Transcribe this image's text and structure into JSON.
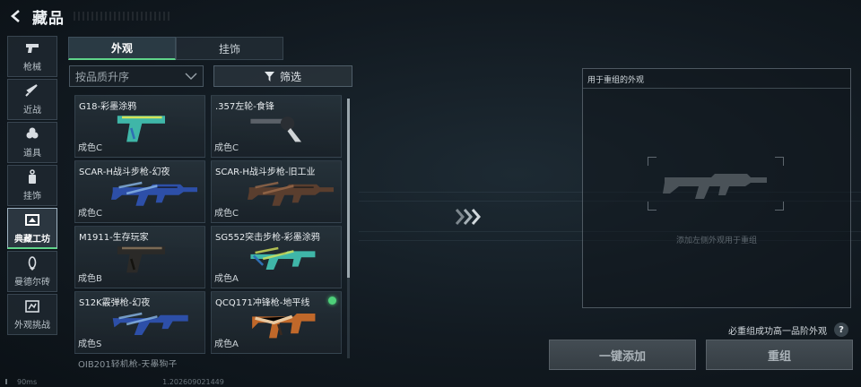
{
  "header": {
    "title": "藏品"
  },
  "sidebar": {
    "items": [
      {
        "label": "枪械",
        "icon": "pistol-icon",
        "active": false
      },
      {
        "label": "近战",
        "icon": "knife-icon",
        "active": false
      },
      {
        "label": "道具",
        "icon": "grenade-icon",
        "active": false
      },
      {
        "label": "挂饰",
        "icon": "charm-icon",
        "active": false
      },
      {
        "label": "典藏工坊",
        "icon": "workshop-icon",
        "active": true
      },
      {
        "label": "曼德尔砖",
        "icon": "brick-icon",
        "active": false
      },
      {
        "label": "外观挑战",
        "icon": "challenge-icon",
        "active": false
      }
    ]
  },
  "tabs": [
    {
      "label": "外观",
      "active": true
    },
    {
      "label": "挂饰",
      "active": false
    }
  ],
  "sort": {
    "value": "按品质升序"
  },
  "filter": {
    "label": "筛选"
  },
  "items": [
    {
      "name": "G18-彩墨涂鸦",
      "grade": "成色C",
      "gun": "pistol",
      "colors": [
        "#3fb6a8",
        "#d4e35a",
        "#2f6fb4"
      ]
    },
    {
      "name": ".357左轮-食锋",
      "grade": "成色C",
      "gun": "revolver",
      "colors": [
        "#2a2e33",
        "#5b6168",
        "#cfd3d6"
      ]
    },
    {
      "name": "SCAR-H战斗步枪-幻夜",
      "grade": "成色C",
      "gun": "rifle",
      "colors": [
        "#2d4fa8",
        "#8ab8e8",
        "#1a2340"
      ]
    },
    {
      "name": "SCAR-H战斗步枪-旧工业",
      "grade": "成色C",
      "gun": "rifle",
      "colors": [
        "#5a3e2e",
        "#9a6a4a",
        "#2a2420"
      ]
    },
    {
      "name": "M1911-生存玩家",
      "grade": "成色B",
      "gun": "pistol",
      "colors": [
        "#2b2a28",
        "#7a6a55",
        "#14130f"
      ]
    },
    {
      "name": "SG552突击步枪-彩墨涂鸦",
      "grade": "成色A",
      "gun": "carbine",
      "colors": [
        "#3fb6a8",
        "#d4e35a",
        "#2f6fb4"
      ]
    },
    {
      "name": "S12K霰弹枪-幻夜",
      "grade": "成色S",
      "gun": "shotgun",
      "colors": [
        "#2d4fa8",
        "#8ab8e8",
        "#1a2340"
      ]
    },
    {
      "name": "QCQ171冲锋枪-地平线",
      "grade": "成色A",
      "gun": "smg",
      "colors": [
        "#c0682a",
        "#e8c8a0",
        "#3a2a20"
      ],
      "new": true
    }
  ],
  "partial_item": {
    "name": "QJB201轻机枪-天墨狗子"
  },
  "panel": {
    "title": "用于重组的外观",
    "hint": "添加左侧外观用于重组"
  },
  "help": {
    "text": "必重组成功高一品阶外观",
    "icon_label": "?"
  },
  "buttons": {
    "add_all": "一键添加",
    "recombine": "重组"
  },
  "status": {
    "ping": "90ms",
    "build": "1.202609021449"
  }
}
